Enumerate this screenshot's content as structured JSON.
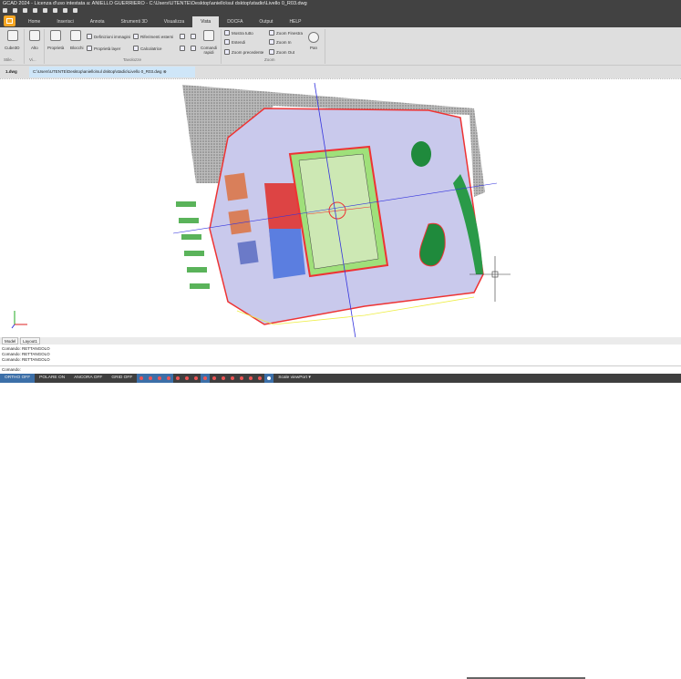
{
  "window": {
    "title": "GCAD 2024 - Licenza d'uso intestata a: ANIELLO GUERRIERO - C:\\Users\\UTENTE\\Desktop\\aniello\\sul dsktop\\stadio\\Livello 0_R03.dwg"
  },
  "ribbon_tabs": [
    {
      "label": "Home"
    },
    {
      "label": "Inserisci"
    },
    {
      "label": "Annota"
    },
    {
      "label": "Strumenti 3D"
    },
    {
      "label": "Visualizza"
    },
    {
      "label": "Vista",
      "active": true
    },
    {
      "label": "DOCFA"
    },
    {
      "label": "Output"
    },
    {
      "label": "HELP"
    }
  ],
  "ribbon": {
    "cube3d": "Cube3D",
    "alto": "Alto",
    "proprieta": "Proprietà",
    "blocchi": "Blocchi",
    "definizioni_immagini": "Definizioni immagini",
    "proprieta_layer": "Proprietà layer",
    "riferimenti_esterni": "Riferimenti esterni",
    "calcolatrice": "Calcolatrice",
    "comandi_rapidi": "Comandi rapidi",
    "mostra_tutto": "Mostra tutto",
    "estendi": "Estendi",
    "zoom_precedente": "Zoom precedente",
    "zoom_finestra": "Zoom Finestra",
    "zoom_in": "Zoom In",
    "zoom_out": "Zoom Out",
    "pan": "Pan",
    "groups": {
      "stile": "Stile...",
      "vi": "Vi...",
      "tavolozze": "Tavolozze",
      "zoom": "Zoom"
    }
  },
  "doc_tabs": [
    {
      "label": "1.dwg"
    },
    {
      "label": "C:\\Users\\UTENTE\\Desktop\\aniello\\sul dsktop\\stadio\\Livello 0_R03.dwg",
      "active": true
    }
  ],
  "layout_tabs": [
    {
      "label": "Model"
    },
    {
      "label": "Layout1"
    }
  ],
  "command_history": [
    "Comando: RETTANGOLO",
    "Comando: RETTANGOLO",
    "Comando: RETTANGOLO"
  ],
  "command_prompt": "Comando:",
  "status": {
    "ortho": "ORTHO OFF",
    "polare": "POLARE ON",
    "ancora": "ANCORA OFF",
    "grid": "GRID OFF",
    "scale": "Scale viewPort ▾"
  },
  "colors": {
    "accent": "#3c6fa8",
    "titlebar": "#424242",
    "ribbon": "#dedede",
    "pitch": "#a8d88a",
    "plaza": "#c9c9ec"
  }
}
